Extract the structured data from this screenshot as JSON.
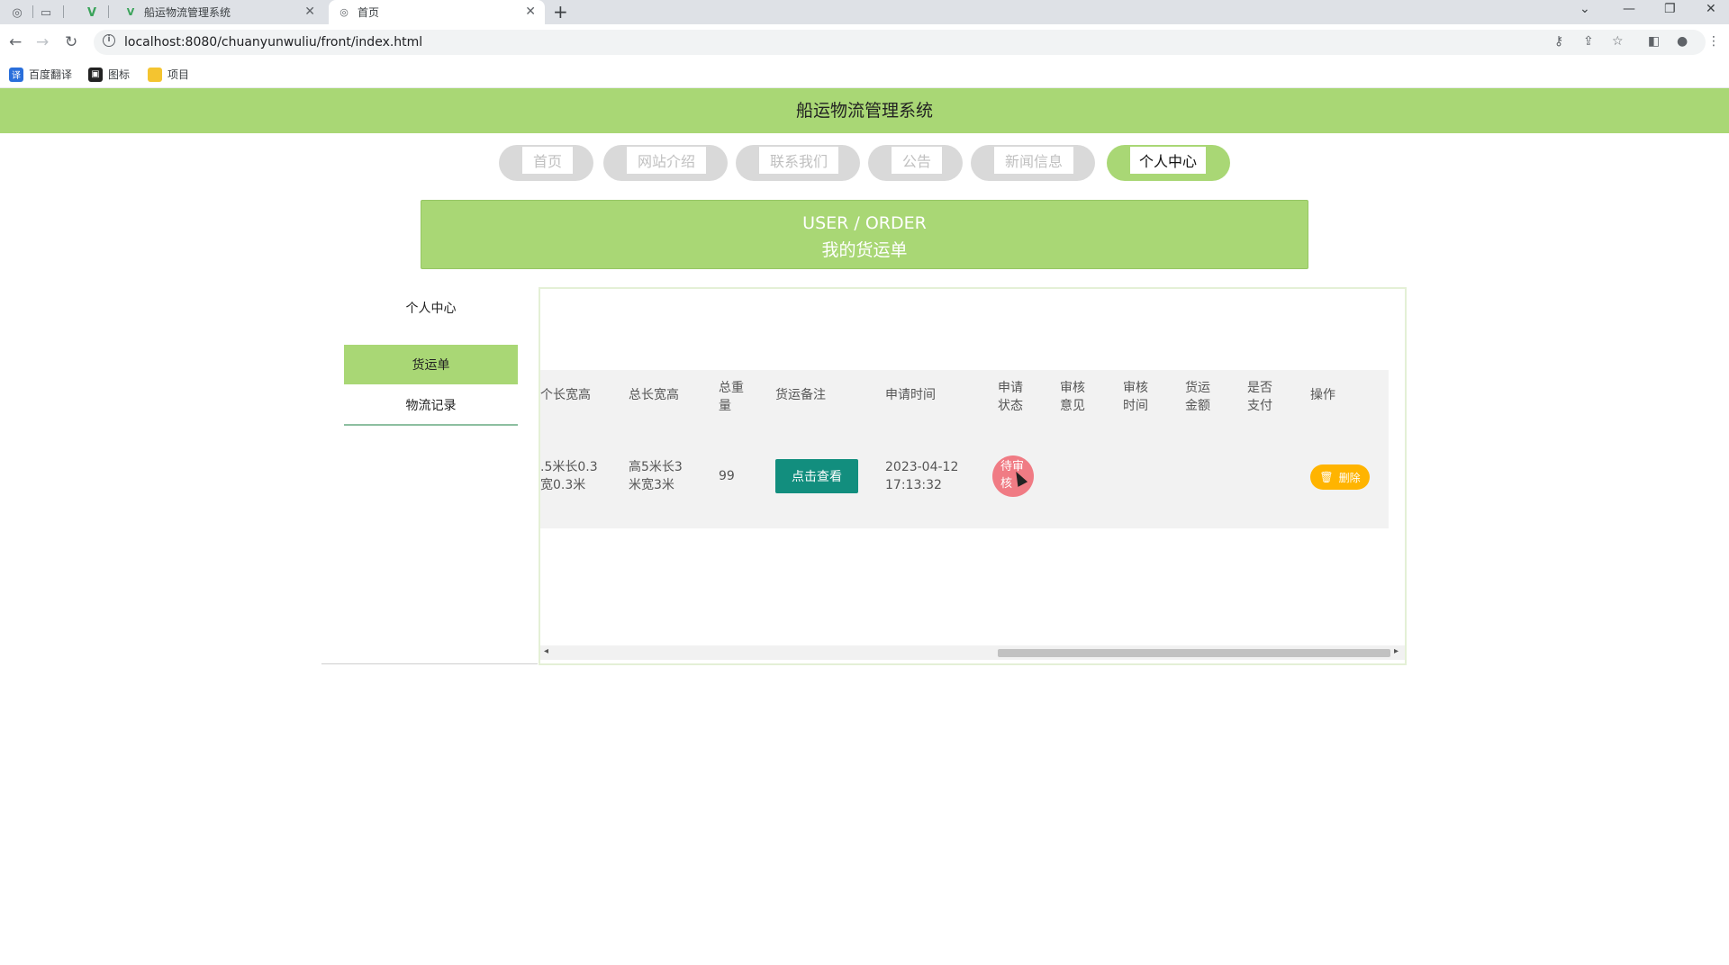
{
  "browser": {
    "tabs": [
      {
        "title": "船运物流管理系统",
        "active": false
      },
      {
        "title": "首页",
        "active": true
      }
    ],
    "url": "localhost:8080/chuanyunwuliu/front/index.html",
    "bookmarks": [
      "百度翻译",
      "图标",
      "项目"
    ]
  },
  "site": {
    "title": "船运物流管理系统",
    "nav": [
      "首页",
      "网站介绍",
      "联系我们",
      "公告",
      "新闻信息",
      "个人中心"
    ],
    "active_nav": "个人中心"
  },
  "banner": {
    "en": "USER / ORDER",
    "cn": "我的货运单"
  },
  "sidebar": {
    "items": [
      "个人中心",
      "货运单",
      "物流记录"
    ],
    "active": "货运单"
  },
  "table": {
    "headers": {
      "single_size": "个长宽高",
      "total_size": "总长宽高",
      "total_weight": "总重量",
      "remark": "货运备注",
      "apply_time": "申请时间",
      "apply_status": "申请状态",
      "review_opinion": "审核意见",
      "review_time": "审核时间",
      "freight_amount": "货运金额",
      "paid": "是否支付",
      "actions": "操作"
    },
    "headers_split": {
      "total_weight": [
        "总重",
        "量"
      ],
      "apply_status": [
        "申请",
        "状态"
      ],
      "review_opinion": [
        "审核",
        "意见"
      ],
      "review_time": [
        "审核",
        "时间"
      ],
      "freight_amount": [
        "货运",
        "金额"
      ],
      "paid": [
        "是否",
        "支付"
      ]
    },
    "row": {
      "single_size": [
        ".5米长0.3",
        "宽0.3米"
      ],
      "total_size": [
        "高5米长3",
        "米宽3米"
      ],
      "total_weight": "99",
      "remark_button": "点击查看",
      "apply_time": [
        "2023-04-12",
        "17:13:32"
      ],
      "apply_status": [
        "待审",
        "核"
      ],
      "delete_button": "删除"
    }
  },
  "colors": {
    "brand_green": "#a9d775",
    "view_button": "#128e7e",
    "status_badge": "#f07b84",
    "delete_button": "#ffb400"
  }
}
